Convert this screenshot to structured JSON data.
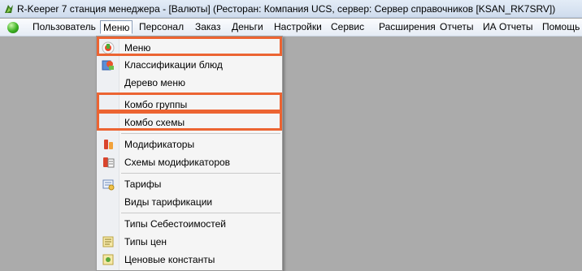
{
  "window": {
    "title": "R-Keeper 7 станция менеджера - [Валюты] (Ресторан: Компания UCS, сервер: Сервер справочников [KSAN_RK7SRV])"
  },
  "menubar": {
    "items": [
      {
        "label": "Пользователь"
      },
      {
        "label": "Меню"
      },
      {
        "label": "Персонал"
      },
      {
        "label": "Заказ"
      },
      {
        "label": "Деньги"
      },
      {
        "label": "Настройки"
      },
      {
        "label": "Сервис"
      },
      {
        "label": "Расширения"
      },
      {
        "label": "Отчеты"
      },
      {
        "label": "ИА Отчеты"
      },
      {
        "label": "Помощь"
      }
    ],
    "active_index": 1
  },
  "dropdown": {
    "items": [
      {
        "label": "Меню",
        "icon": "menu-icon",
        "highlighted": true
      },
      {
        "label": "Классификации блюд",
        "icon": "classifications-icon"
      },
      {
        "label": "Дерево меню",
        "icon": ""
      },
      {
        "label": "Комбо группы",
        "icon": "",
        "highlighted": true
      },
      {
        "label": "Комбо схемы",
        "icon": "",
        "highlighted": true
      },
      {
        "label": "Модификаторы",
        "icon": "modifiers-icon"
      },
      {
        "label": "Схемы модификаторов",
        "icon": "modifier-schemes-icon"
      },
      {
        "label": "Тарифы",
        "icon": "tariffs-icon"
      },
      {
        "label": "Виды тарификации",
        "icon": ""
      },
      {
        "label": "Типы Себестоимостей",
        "icon": ""
      },
      {
        "label": "Типы цен",
        "icon": "price-types-icon"
      },
      {
        "label": "Ценовые константы",
        "icon": "price-constants-icon"
      }
    ]
  },
  "colors": {
    "highlight_border": "#ec6432",
    "workspace": "#ababab"
  }
}
